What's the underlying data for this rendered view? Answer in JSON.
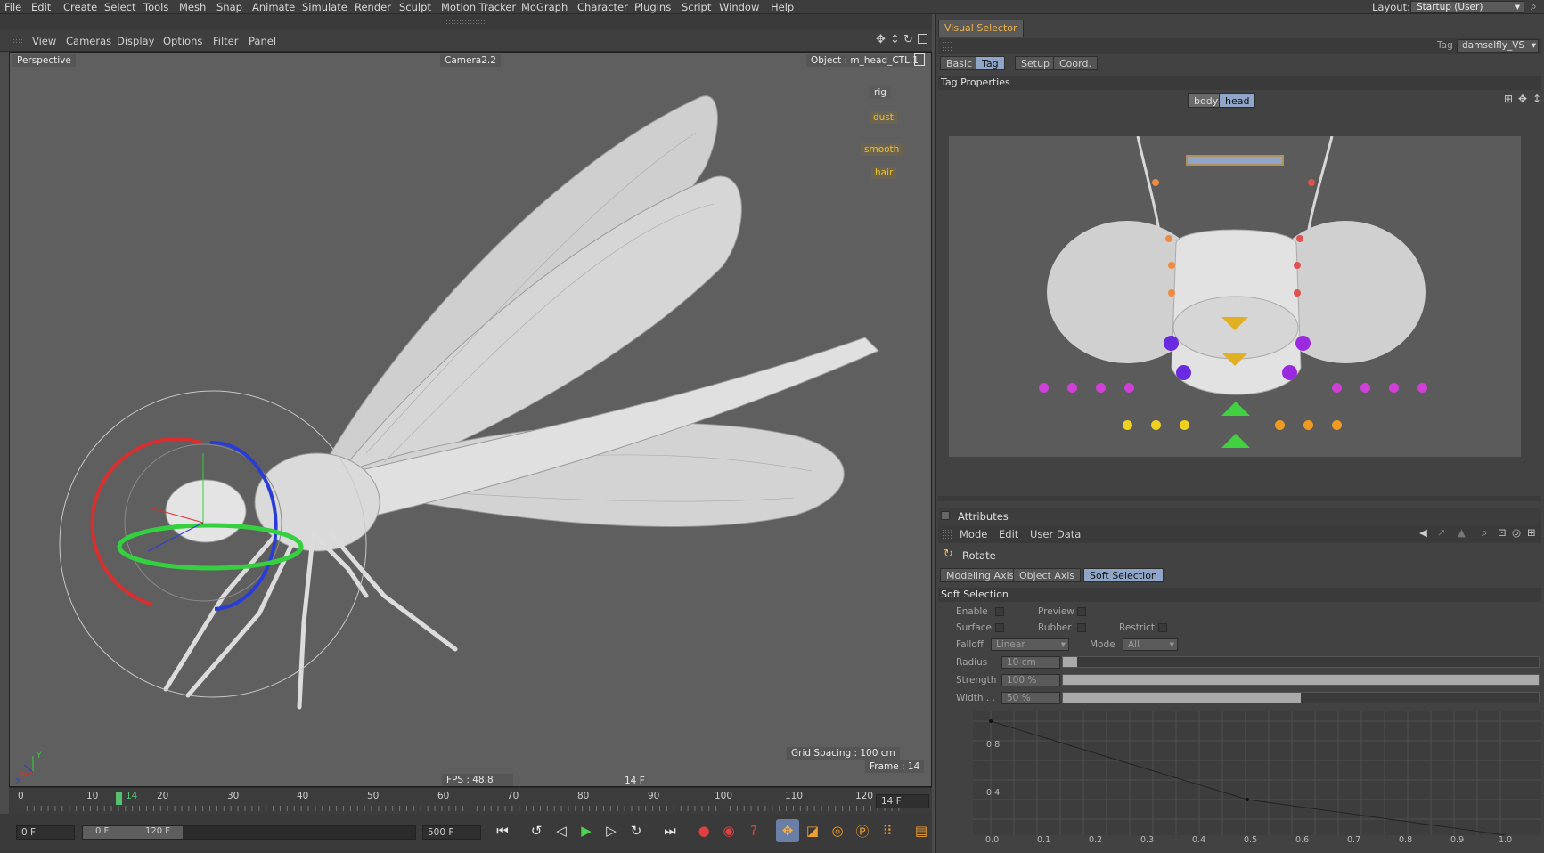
{
  "menubar": {
    "items": [
      "File",
      "Edit",
      "Create",
      "Select",
      "Tools",
      "Mesh",
      "Snap",
      "Animate",
      "Simulate",
      "Render",
      "Sculpt",
      "Motion Tracker",
      "MoGraph",
      "Character",
      "Plugins",
      "Script",
      "Window",
      "Help"
    ],
    "layout_label": "Layout:",
    "layout_value": "Startup (User)"
  },
  "viewport_menu": [
    "View",
    "Cameras",
    "Display",
    "Options",
    "Filter",
    "Panel"
  ],
  "viewport": {
    "view_name": "Perspective",
    "camera": "Camera2.2",
    "object": "Object : m_head_CTL.1",
    "tags": [
      {
        "label": "rig",
        "style": "plain"
      },
      {
        "label": "dust",
        "style": "gold"
      },
      {
        "label": "smooth",
        "style": "gold"
      },
      {
        "label": "hair",
        "style": "gold"
      }
    ],
    "grid_spacing": "Grid Spacing : 100 cm",
    "frame": "Frame : 14",
    "fps": "FPS : 48.8",
    "frame_indicator": "14 F",
    "axis_y": "Y",
    "axis_x": "X",
    "axis_z": "Z"
  },
  "timeline": {
    "ticks": [
      "0",
      "10",
      "14",
      "20",
      "30",
      "40",
      "50",
      "60",
      "70",
      "80",
      "90",
      "100",
      "110",
      "120"
    ],
    "current_frame_field": "14 F",
    "playhead_frame": 14
  },
  "transport": {
    "start_field": "0 F",
    "range_start": "0 F",
    "range_end": "120 F",
    "end_field": "500 F"
  },
  "visual_selector": {
    "panel_title": "Visual Selector",
    "tag_label": "Tag",
    "tag_value": "damselfly_VS",
    "tabs": [
      "Basic",
      "Tag",
      "Setup",
      "Coord."
    ],
    "active_tab": "Tag",
    "section_title": "Tag Properties",
    "mode_buttons": [
      "body",
      "head"
    ],
    "active_mode": "head"
  },
  "attributes": {
    "title": "Attributes",
    "menu": [
      "Mode",
      "Edit",
      "User Data"
    ],
    "tool_name": "Rotate",
    "tabs": [
      "Modeling Axis",
      "Object Axis",
      "Soft Selection"
    ],
    "active_tab": "Soft Selection",
    "section_title": "Soft Selection",
    "enable_label": "Enable",
    "preview_label": "Preview",
    "surface_label": "Surface",
    "rubber_label": "Rubber",
    "restrict_label": "Restrict",
    "falloff_label": "Falloff",
    "falloff_value": "Linear",
    "mode_label": "Mode",
    "mode_value": "All",
    "radius_label": "Radius",
    "radius_value": "10 cm",
    "strength_label": "Strength",
    "strength_value": "100 %",
    "width_label": "Width . .",
    "width_value": "50 %",
    "radius_fill": 0.003,
    "strength_fill": 1.0,
    "width_fill": 0.5
  },
  "graph": {
    "x_ticks": [
      "0.0",
      "0.1",
      "0.2",
      "0.3",
      "0.4",
      "0.5",
      "0.6",
      "0.7",
      "0.8",
      "0.9",
      "1.0"
    ],
    "y_ticks": [
      "0.8",
      "0.4"
    ]
  },
  "colors": {
    "accent_orange": "#f0b24a",
    "active_tab_blue": "#8fa6c8",
    "gizmo_red": "#d83030",
    "gizmo_green": "#34d040",
    "gizmo_blue": "#2a3cd8"
  }
}
